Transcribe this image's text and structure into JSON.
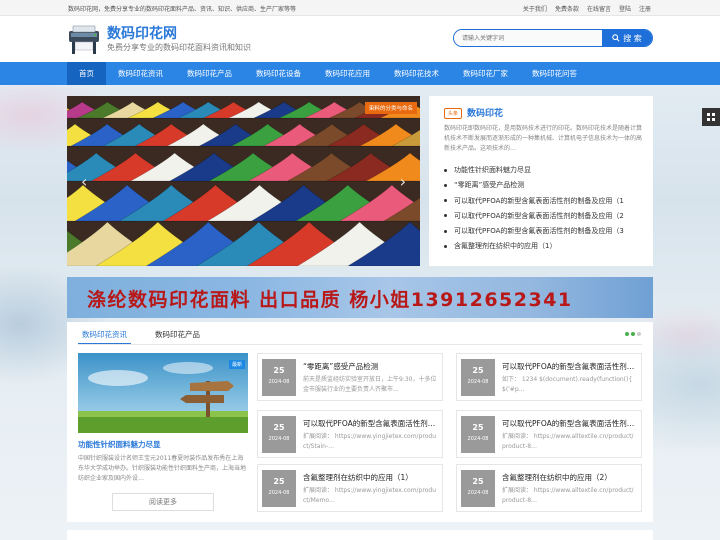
{
  "topbar": {
    "intro": "数码印花网，免费分享专业的数码印花面料产品、资讯、知识、供应商、生产厂家等等",
    "links": [
      "关于我们",
      "免费条款",
      "在线留言",
      "登陆",
      "注册"
    ]
  },
  "header": {
    "title": "数码印花网",
    "subtitle": "免费分享专业的数码印花面料资讯和知识",
    "search_placeholder": "请输入关键字词",
    "search_button": "搜 索"
  },
  "nav": [
    "首页",
    "数码印花资讯",
    "数码印花产品",
    "数码印花设备",
    "数码印花应用",
    "数码印花技术",
    "数码印花厂家",
    "数码印花问答"
  ],
  "slider": {
    "tag": "染料的分类与命名"
  },
  "panel": {
    "badge": "头条",
    "title": "数码印花",
    "desc": "数码印花即数码印花，是用数码技术进行的印花。数码印花技术是随着计算机技术不断发展而逐渐形成的一种集机械、计算机电子信息技术为一体的高新技术产品。这项技术的…",
    "items": [
      "功能性针织面料魅力尽显",
      "“零距离”感受产品检测",
      "可以取代PFOA的新型含氟表面活性剂的制备及应用（1",
      "可以取代PFOA的新型含氟表面活性剂的制备及应用（2",
      "可以取代PFOA的新型含氟表面活性剂的制备及应用（3",
      "含氟整理剂在纺织中的应用（1）"
    ]
  },
  "banner": {
    "text": "涤纶数码印花面料 出口品质 杨小姐13912652341"
  },
  "tabs": [
    "数码印花资讯",
    "数码印花产品"
  ],
  "featured": {
    "badge": "最新",
    "title": "功能性针织面料魅力尽显",
    "desc": "中国针织服装设计名师王宝元2011春夏时装作品发布秀在上海东华大学成功举办。针织服装功能性针织面料生产商，上海当地纺织企业家及国内外设…",
    "read_more": "阅读更多"
  },
  "cards": [
    {
      "day": "25",
      "month": "2024-08",
      "title": "“零距离”感受产品检测",
      "summary": "前天是质监经纺实验室开放日，上午9:30，十多位金市服装行业的主要负责人齐聚市…"
    },
    {
      "day": "25",
      "month": "2024-08",
      "title": "可以取代PFOA的新型含氟表面活性剂的制备及应用（1）",
      "summary": "如下： 1234 $(document).ready(function(){ $('#p…"
    },
    {
      "day": "25",
      "month": "2024-08",
      "title": "可以取代PFOA的新型含氟表面活性剂的制备及应用（2）",
      "summary": "扩展阅读： https://www.yingjietex.com/product/Stain-…"
    },
    {
      "day": "25",
      "month": "2024-08",
      "title": "可以取代PFOA的新型含氟表面活性剂的制备及应用（3）",
      "summary": "扩展阅读： https://www.alltextile.cn/product/product-8…"
    },
    {
      "day": "25",
      "month": "2024-08",
      "title": "含氟整理剂在纺织中的应用（1）",
      "summary": "扩展阅读： https://www.yingjietex.com/product/Memo…"
    },
    {
      "day": "25",
      "month": "2024-08",
      "title": "含氟整理剂在纺织中的应用（2）",
      "summary": "扩展阅读： https://www.alltextile.cn/product/product-8…"
    }
  ],
  "colors": {
    "primary": "#2b85e4",
    "nav_active": "#1565c0",
    "accent": "#e8690e",
    "banner_text": "#b81818"
  }
}
